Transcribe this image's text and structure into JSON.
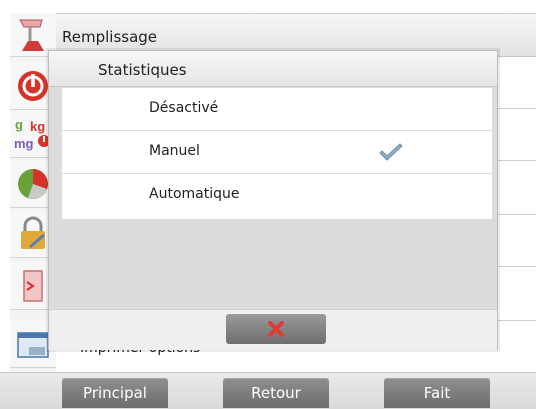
{
  "header": {
    "title": "Remplissage"
  },
  "background_row_text": "Imprimer options",
  "sidebar": {
    "icons": [
      {
        "name": "filling-icon"
      },
      {
        "name": "power-icon"
      },
      {
        "name": "units-icon"
      },
      {
        "name": "pie-chart-icon"
      },
      {
        "name": "lock-icon"
      },
      {
        "name": "door-exit-icon"
      },
      {
        "name": "print-options-icon"
      }
    ],
    "units_icon_text": [
      "g",
      "kg",
      "mg"
    ]
  },
  "dialog": {
    "title": "Statistiques",
    "options": [
      {
        "label": "Désactivé",
        "selected": false
      },
      {
        "label": "Manuel",
        "selected": true
      },
      {
        "label": "Automatique",
        "selected": false
      }
    ],
    "cancel_icon": "close-x-icon"
  },
  "nav": {
    "principal": "Principal",
    "retour": "Retour",
    "fait": "Fait"
  },
  "colors": {
    "button_gray": "#7d7d7d",
    "accent_red": "#d6332a",
    "check_blue": "#8fb0c8"
  }
}
